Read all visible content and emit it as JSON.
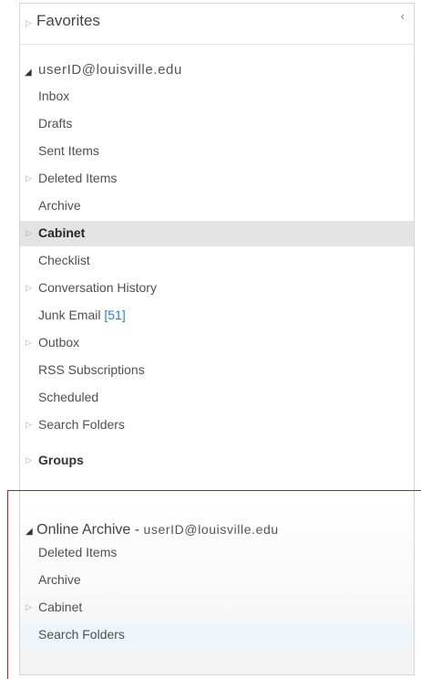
{
  "favorites": {
    "label": "Favorites",
    "collapse_glyph": "‹"
  },
  "account": {
    "name": "userID@louisville.edu"
  },
  "folders": [
    {
      "label": "Inbox",
      "expandable": false
    },
    {
      "label": "Drafts",
      "expandable": false
    },
    {
      "label": "Sent Items",
      "expandable": false
    },
    {
      "label": "Deleted Items",
      "expandable": true
    },
    {
      "label": "Archive",
      "expandable": false
    },
    {
      "label": "Cabinet",
      "expandable": true,
      "selected": true
    },
    {
      "label": "Checklist",
      "expandable": false
    },
    {
      "label": "Conversation History",
      "expandable": true
    },
    {
      "label": "Junk Email",
      "count": "[51]",
      "expandable": false
    },
    {
      "label": "Outbox",
      "expandable": true
    },
    {
      "label": "RSS Subscriptions",
      "expandable": false
    },
    {
      "label": "Scheduled",
      "expandable": false
    },
    {
      "label": "Search Folders",
      "expandable": true
    }
  ],
  "groups": {
    "label": "Groups"
  },
  "online_archive": {
    "title": "Online Archive -",
    "account": "userID@louisville.edu",
    "folders": [
      {
        "label": "Deleted Items",
        "expandable": false
      },
      {
        "label": "Archive",
        "expandable": false
      },
      {
        "label": "Cabinet",
        "expandable": true
      },
      {
        "label": "Search Folders",
        "expandable": false,
        "highlighted": true
      }
    ]
  },
  "icons": {
    "collapsed": "▷",
    "expanded": "◢"
  },
  "colors": {
    "selected_bg": "#e3e3e3",
    "unread_count": "#2b7cd3",
    "annotation_line": "#b21f2d"
  }
}
